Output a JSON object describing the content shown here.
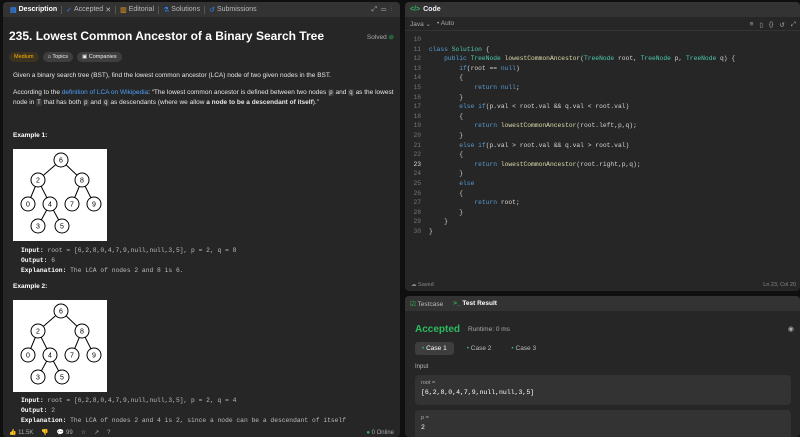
{
  "left_tabs": [
    {
      "label": "Description",
      "icon": "doc-icon"
    },
    {
      "label": "Accepted",
      "icon": "check-icon"
    },
    {
      "label": "Editorial",
      "icon": "book-icon"
    },
    {
      "label": "Solutions",
      "icon": "flask-icon"
    },
    {
      "label": "Submissions",
      "icon": "history-icon"
    }
  ],
  "problem": {
    "title": "235. Lowest Common Ancestor of a Binary Search Tree",
    "status": "Solved",
    "difficulty": "Medium",
    "topics": "Topics",
    "companies": "Companies",
    "p1": "Given a binary search tree (BST), find the lowest common ancestor (LCA) node of two given nodes in the BST.",
    "p2a": "According to the ",
    "p2link": "definition of LCA on Wikipedia",
    "p2b": ": “The lowest common ancestor is defined between two nodes ",
    "p2c": " and ",
    "p2d": " as the lowest node in ",
    "p2e": " that has both ",
    "p2f": " and ",
    "p2g": " as descendants (where we allow ",
    "p2bold": "a node to be a descendant of itself",
    "p2h": ").”",
    "code_p": "p",
    "code_q": "q",
    "code_T": "T",
    "ex1_title": "Example 1:",
    "ex2_title": "Example 2:",
    "ex1": {
      "input_label": "Input:",
      "input": " root = [6,2,8,0,4,7,9,null,null,3,5], p = 2, q = 8",
      "output_label": "Output:",
      "output": " 6",
      "expl_label": "Explanation:",
      "expl": " The LCA of nodes 2 and 8 is 6."
    },
    "ex2": {
      "input_label": "Input:",
      "input": " root = [6,2,8,0,4,7,9,null,null,3,5], p = 2, q = 4",
      "output_label": "Output:",
      "output": " 2",
      "expl_label": "Explanation:",
      "expl": " The LCA of nodes 2 and 4 is 2, since a node can be a descendant of itself"
    },
    "tree_nodes": [
      "6",
      "2",
      "8",
      "0",
      "4",
      "7",
      "9",
      "3",
      "5"
    ]
  },
  "footer": {
    "likes": "11.5K",
    "comments": "99",
    "online": "0 Online"
  },
  "code_panel": {
    "title": "Code",
    "language": "Java",
    "auto": "Auto",
    "saved": "Saved",
    "cursor": "Ln 23, Col 20",
    "lines": [
      {
        "n": "10",
        "t": ""
      },
      {
        "n": "11",
        "t": "class Solution {"
      },
      {
        "n": "12",
        "t": "    public TreeNode lowestCommonAncestor(TreeNode root, TreeNode p, TreeNode q) {"
      },
      {
        "n": "13",
        "t": "        if(root == null)"
      },
      {
        "n": "14",
        "t": "        {"
      },
      {
        "n": "15",
        "t": "            return null;"
      },
      {
        "n": "16",
        "t": "        }"
      },
      {
        "n": "17",
        "t": "        else if(p.val < root.val && q.val < root.val)"
      },
      {
        "n": "18",
        "t": "        {"
      },
      {
        "n": "19",
        "t": "            return lowestCommonAncestor(root.left,p,q);"
      },
      {
        "n": "20",
        "t": "        }"
      },
      {
        "n": "21",
        "t": "        else if(p.val > root.val && q.val > root.val)"
      },
      {
        "n": "22",
        "t": "        {"
      },
      {
        "n": "23",
        "t": "            return lowestCommonAncestor(root.right,p,q);"
      },
      {
        "n": "24",
        "t": "        }"
      },
      {
        "n": "25",
        "t": "        else"
      },
      {
        "n": "26",
        "t": "        {"
      },
      {
        "n": "27",
        "t": "            return root;"
      },
      {
        "n": "28",
        "t": "        }"
      },
      {
        "n": "29",
        "t": "    }"
      },
      {
        "n": "30",
        "t": "}"
      }
    ]
  },
  "result_panel": {
    "tab_testcase": "Testcase",
    "tab_result": "Test Result",
    "status": "Accepted",
    "runtime": "Runtime: 0 ms",
    "cases": [
      "Case 1",
      "Case 2",
      "Case 3"
    ],
    "input_label": "Input",
    "root_label": "root =",
    "root_value": "[6,2,8,0,4,7,9,null,null,3,5]",
    "p_label": "p =",
    "p_value": "2"
  },
  "colors": {
    "accent": "#ffa116",
    "accepted": "#2cbb5d",
    "link": "#4d9ff7"
  }
}
